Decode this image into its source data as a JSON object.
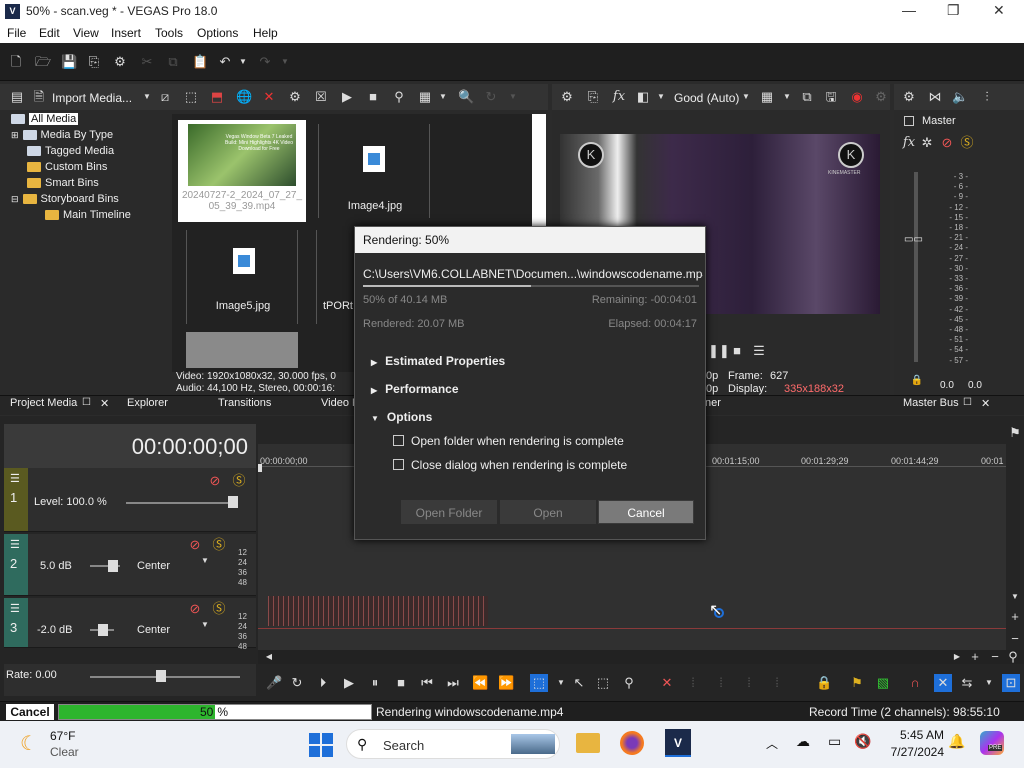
{
  "window": {
    "title": "50% - scan.veg * - VEGAS Pro 18.0",
    "logo": "V"
  },
  "menu": [
    "File",
    "Edit",
    "View",
    "Insert",
    "Tools",
    "Options",
    "Help"
  ],
  "project_media": {
    "import_label": "Import Media...",
    "tree": [
      "All Media",
      "Media By Type",
      "Tagged Media",
      "Custom Bins",
      "Smart Bins",
      "Storyboard Bins",
      "Main Timeline"
    ],
    "files": [
      {
        "name": "20240727-2_2024_07_27_05_39_39.mp4"
      },
      {
        "name": "Image4.jpg"
      },
      {
        "name": "Image5.jpg"
      },
      {
        "name": "tPORt...1.9"
      }
    ],
    "thumb_text": "Vegas Window Beta 7 Leaked Build: Mini Highlights 4K Video Download for Free",
    "info_line1": "Video: 1920x1080x32, 30.000 fps, 0",
    "info_line2": "Audio: 44,100 Hz, Stereo, 00:00:16:"
  },
  "tabs": [
    "Project Media",
    "Explorer",
    "Transitions",
    "Video F",
    "ner",
    "Master Bus"
  ],
  "preview": {
    "quality": "Good (Auto)",
    "frame_label": "Frame:",
    "frame": "627",
    "display_label": "Display:",
    "display": "335x188x32",
    "p_label1": "0p",
    "p_label2": "0p",
    "brand": "KINEMASTER"
  },
  "master": {
    "label": "Master",
    "scale": [
      "3",
      "6",
      "9",
      "12",
      "15",
      "18",
      "21",
      "24",
      "27",
      "30",
      "33",
      "36",
      "39",
      "42",
      "45",
      "48",
      "51",
      "54",
      "57"
    ],
    "left_val": "0.0",
    "right_val": "0.0"
  },
  "timeline": {
    "timecode": "00:00:00;00",
    "ruler": [
      "00:00:00;00",
      "00:01:15;00",
      "00:01:29;29",
      "00:01:44;29",
      "00:01"
    ],
    "tracks": [
      {
        "num": "1",
        "label": "Level: 100.0 %"
      },
      {
        "num": "2",
        "db": "5.0 dB",
        "pan": "Center",
        "meter": [
          "12",
          "24",
          "36",
          "48"
        ]
      },
      {
        "num": "3",
        "db": "-2.0 dB",
        "pan": "Center",
        "meter": [
          "12",
          "24",
          "36",
          "48"
        ]
      }
    ],
    "rate": "Rate: 0.00"
  },
  "dialog": {
    "title": "Rendering: 50%",
    "path": "C:\\Users\\VM6.COLLABNET\\Documen...\\windowscodename.mp4",
    "progress_text": "50% of 40.14 MB",
    "remaining": "Remaining: -00:04:01",
    "rendered": "Rendered: 20.07 MB",
    "elapsed": "Elapsed: 00:04:17",
    "progress": 0.5,
    "sections": [
      "Estimated Properties",
      "Performance",
      "Options"
    ],
    "options": [
      "Open folder when rendering is complete",
      "Close dialog when rendering is complete"
    ],
    "buttons": [
      "Open Folder",
      "Open",
      "Cancel"
    ]
  },
  "status": {
    "cancel": "Cancel",
    "percent": "50",
    "percent_sign": "%",
    "progress": 0.5,
    "message": "Rendering windowscodename.mp4",
    "record_time": "Record Time (2 channels): 98:55:10"
  },
  "taskbar": {
    "temp": "67°F",
    "weather": "Clear",
    "search": "Search",
    "time": "5:45 AM",
    "date": "7/27/2024",
    "copilot_badge": "PRE"
  },
  "colors": {
    "accent": "#1e6fd9",
    "progress_green": "#2db52d",
    "display_red": "#ff6b6b",
    "track_video": "#5a5a20",
    "track_audio": "#2f6b5e"
  }
}
